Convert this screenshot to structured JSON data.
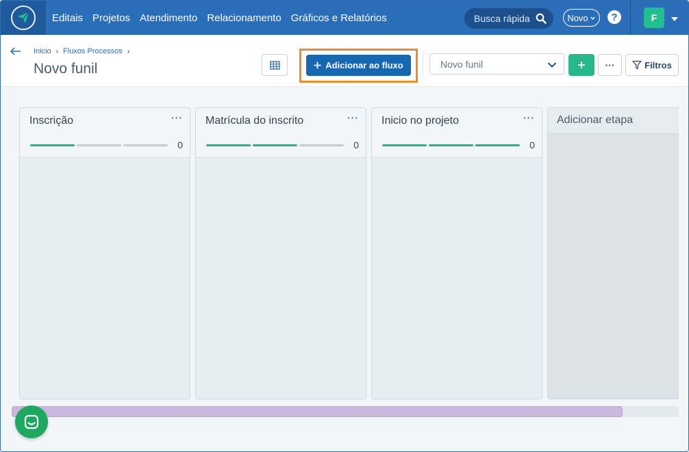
{
  "nav": {
    "items": [
      "Editais",
      "Projetos",
      "Atendimento",
      "Relacionamento",
      "Gráficos e Relatórios"
    ],
    "search_placeholder": "Busca rápida",
    "novo_label": "Novo",
    "help_label": "?",
    "avatar_initial": "F"
  },
  "header": {
    "breadcrumb": [
      "Inicio",
      "Fluxos Processos"
    ],
    "title": "Novo funil",
    "add_button_label": "Adicionar ao fluxo",
    "funnel_selected": "Novo funil",
    "filters_label": "Filtros",
    "more_label": "···"
  },
  "board": {
    "columns": [
      {
        "title": "Inscrição",
        "count": "0",
        "progress_done": 1
      },
      {
        "title": "Matrícula do inscrito",
        "count": "0",
        "progress_done": 2
      },
      {
        "title": "Inicio no projeto",
        "count": "0",
        "progress_done": 3
      }
    ],
    "add_stage_label": "Adicionar etapa",
    "scroll_fraction": 0.916
  },
  "colors": {
    "nav_bg": "#2a6db8",
    "primary": "#1766b0",
    "success": "#26b888",
    "highlight": "#f08a2c",
    "progress_done": "#1fb389"
  }
}
